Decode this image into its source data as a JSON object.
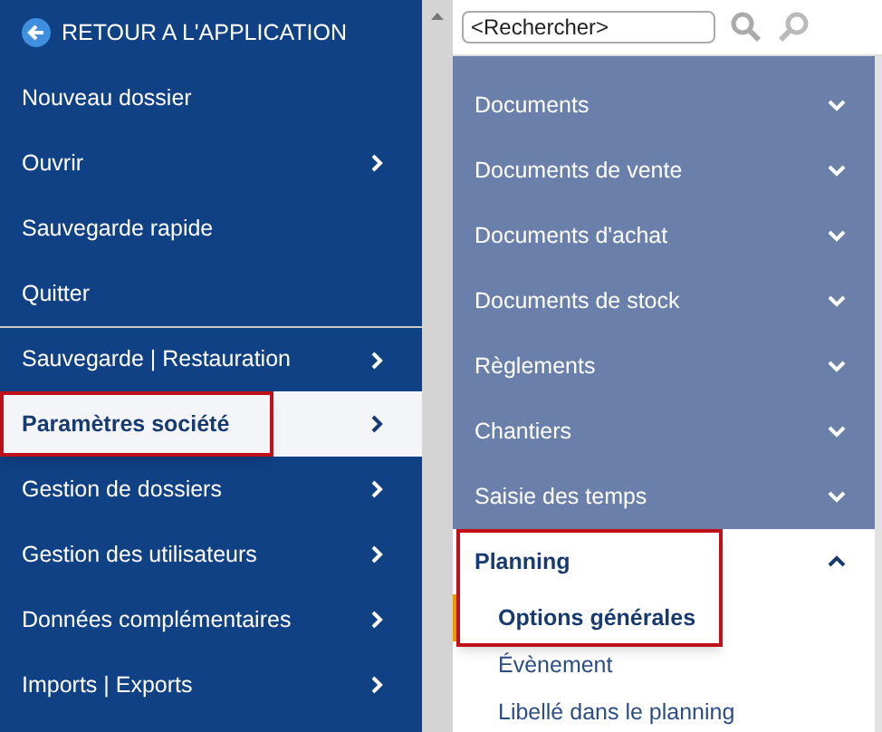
{
  "left_menu": {
    "back_label": "RETOUR A L'APPLICATION",
    "items": [
      {
        "label": "Nouveau dossier",
        "submenu": false,
        "selected": false,
        "highlighted": false,
        "separator_before": false
      },
      {
        "label": "Ouvrir",
        "submenu": true,
        "selected": false,
        "highlighted": false,
        "separator_before": false
      },
      {
        "label": "Sauvegarde rapide",
        "submenu": false,
        "selected": false,
        "highlighted": false,
        "separator_before": false
      },
      {
        "label": "Quitter",
        "submenu": false,
        "selected": false,
        "highlighted": false,
        "separator_before": false
      },
      {
        "label": "Sauvegarde | Restauration",
        "submenu": true,
        "selected": false,
        "highlighted": false,
        "separator_before": true
      },
      {
        "label": "Paramètres société",
        "submenu": true,
        "selected": true,
        "highlighted": true,
        "separator_before": false
      },
      {
        "label": "Gestion de dossiers",
        "submenu": true,
        "selected": false,
        "highlighted": false,
        "separator_before": false
      },
      {
        "label": "Gestion des utilisateurs",
        "submenu": true,
        "selected": false,
        "highlighted": false,
        "separator_before": false
      },
      {
        "label": "Données complémentaires",
        "submenu": true,
        "selected": false,
        "highlighted": false,
        "separator_before": false
      },
      {
        "label": "Imports | Exports",
        "submenu": true,
        "selected": false,
        "highlighted": false,
        "separator_before": false
      }
    ]
  },
  "search": {
    "placeholder": "<Rechercher>"
  },
  "sections": [
    {
      "label": "Documents",
      "expanded": false,
      "highlighted": false
    },
    {
      "label": "Documents de vente",
      "expanded": false,
      "highlighted": false
    },
    {
      "label": "Documents d'achat",
      "expanded": false,
      "highlighted": false
    },
    {
      "label": "Documents de stock",
      "expanded": false,
      "highlighted": false
    },
    {
      "label": "Règlements",
      "expanded": false,
      "highlighted": false
    },
    {
      "label": "Chantiers",
      "expanded": false,
      "highlighted": false
    },
    {
      "label": "Saisie des temps",
      "expanded": false,
      "highlighted": false
    },
    {
      "label": "Planning",
      "expanded": true,
      "highlighted": true,
      "children": [
        {
          "label": "Options générales",
          "selected": true
        },
        {
          "label": "Évènement",
          "selected": false
        },
        {
          "label": "Libellé dans le planning",
          "selected": false
        }
      ]
    }
  ]
}
